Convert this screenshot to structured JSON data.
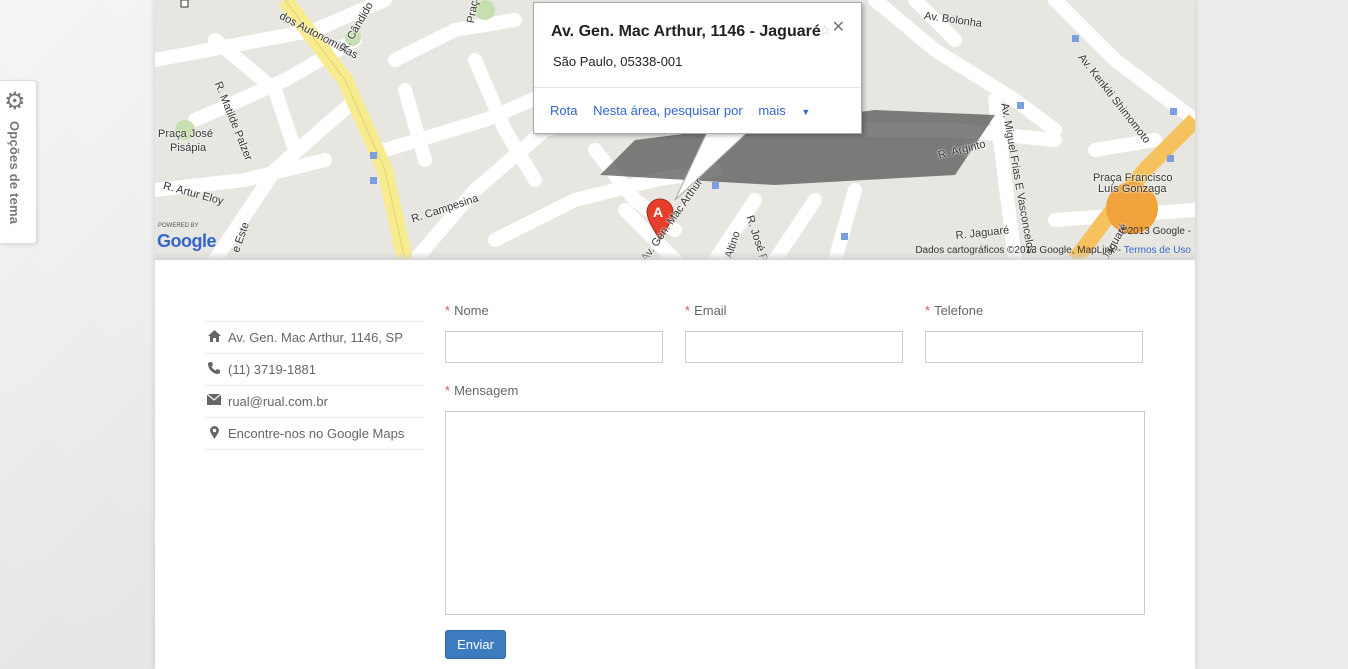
{
  "theme_options": {
    "label": "Opções de tema",
    "icon": "gear-icon"
  },
  "map": {
    "labels": {
      "autonomistas": "dos Autonomistas",
      "rua_candido": "R. Cândido",
      "praca_willi": "Praça Willi",
      "av_bolonha": "Av. Bolonha",
      "kenkiti": "Av. Kenkiti Shimomoto",
      "matilde": "R. Matilde Palzer",
      "praca_jose": "Praça José",
      "pisapia": "Pisápia",
      "artur_eloy": "R. Artur Eloy",
      "campesina": "R. Campesina",
      "mac_arthur": "Av. Gen. Mac Arthur",
      "jose_pe": "R. José Pe",
      "altino": "Altino",
      "argirito": "R. Argirito",
      "miguel_frias": "Av. Miguel Frias E Vasconcelos",
      "jaguare": "R. Jaguaré",
      "praca_francisco": "Praça Francisco",
      "luis_gonzaga": "Luís Gonzaga",
      "este": "e Este",
      "jaguare2": "Jaguaré"
    },
    "copyright": "©2013 Google -",
    "attribution_prefix": "Dados cartográficos ©2013 Google, MapLink -",
    "terms_link": "Termos de Uso",
    "powered_by": "POWERED BY",
    "logo_text": "Google",
    "marker_letter": "A",
    "info_window": {
      "title": "Av. Gen. Mac Arthur, 1146 - Jaguaré",
      "address": "São Paulo, 05338-001",
      "actions": {
        "route": "Rota",
        "search_nearby": "Nesta área, pesquisar por",
        "more": "mais"
      },
      "close_icon": "close-icon"
    }
  },
  "contact": {
    "items": [
      {
        "icon": "home-icon",
        "text": "Av. Gen. Mac Arthur, 1146, SP"
      },
      {
        "icon": "phone-icon",
        "text": "(11) 3719-1881"
      },
      {
        "icon": "envelope-icon",
        "text": "rual@rual.com.br"
      },
      {
        "icon": "map-marker-icon",
        "text": "Encontre-nos no Google Maps"
      }
    ]
  },
  "form": {
    "required_mark": "*",
    "name_label": "Nome",
    "email_label": "Email",
    "phone_label": "Telefone",
    "message_label": "Mensagem",
    "submit_label": "Enviar"
  },
  "colors": {
    "accent": "#3c7cbf",
    "required": "#d9534f",
    "link": "#3366cc"
  }
}
